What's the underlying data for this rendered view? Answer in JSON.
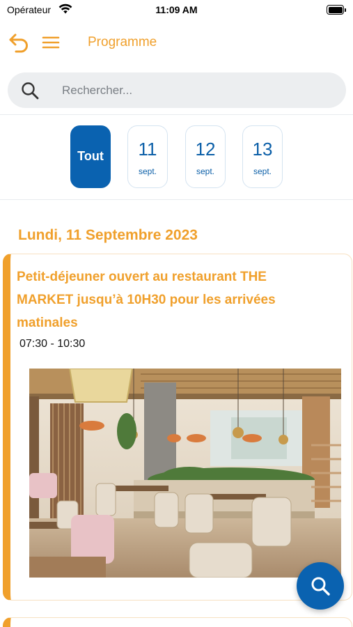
{
  "status_bar": {
    "carrier": "Opérateur",
    "time": "11:09 AM"
  },
  "nav": {
    "title": "Programme",
    "back_icon": "back-arrow-icon",
    "menu_icon": "hamburger-menu-icon"
  },
  "search": {
    "placeholder": "Rechercher...",
    "icon": "search-icon"
  },
  "date_filter": {
    "all_label": "Tout",
    "selected": "Tout",
    "days": [
      {
        "day": "11",
        "month": "sept."
      },
      {
        "day": "12",
        "month": "sept."
      },
      {
        "day": "13",
        "month": "sept."
      }
    ]
  },
  "section": {
    "heading": "Lundi, 11 Septembre 2023"
  },
  "event": {
    "title": "Petit-déjeuner ouvert au restaurant THE MARKET jusqu’à 10H30 pour les arrivées matinales",
    "time": "07:30 - 10:30",
    "image": "restaurant-interior-photo"
  },
  "fab": {
    "icon": "search-icon"
  },
  "colors": {
    "accent_orange": "#f0a02c",
    "primary_blue": "#0a62b0",
    "search_bg": "#eceef0"
  }
}
